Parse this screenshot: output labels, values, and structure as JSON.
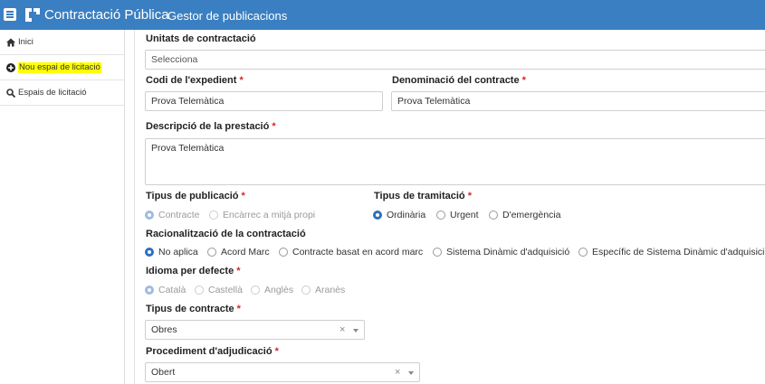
{
  "header": {
    "app_title": "Contractació Pública",
    "app_subtitle": "Gestor de publicacions"
  },
  "sidebar": {
    "items": [
      {
        "label": "Inici",
        "icon": "home-icon"
      },
      {
        "label": "Nou espai de licitació",
        "icon": "plus-circle-icon",
        "highlighted": true
      },
      {
        "label": "Espais de licitació",
        "icon": "search-icon"
      }
    ]
  },
  "form": {
    "unitats": {
      "label": "Unitats de contractació",
      "placeholder": "Selecciona"
    },
    "codi": {
      "label": "Codi de l'expedient",
      "required": "*",
      "value": "Prova Telemàtica"
    },
    "denominacio": {
      "label": "Denominació del contracte",
      "required": "*",
      "value": "Prova Telemàtica"
    },
    "descripcio": {
      "label": "Descripció de la prestació",
      "required": "*",
      "value": "Prova Telemàtica"
    },
    "tipus_publicacio": {
      "label": "Tipus de publicació",
      "required": "*",
      "options": [
        "Contracte",
        "Encàrrec a mitjà propi"
      ],
      "selected": "Contracte",
      "disabled": true
    },
    "tipus_tramitacio": {
      "label": "Tipus de tramitació",
      "required": "*",
      "options": [
        "Ordinària",
        "Urgent",
        "D'emergència"
      ],
      "selected": "Ordinària"
    },
    "racionalitzacio": {
      "label": "Racionalització de la contractació",
      "options": [
        "No aplica",
        "Acord Marc",
        "Contracte basat en acord marc",
        "Sistema Dinàmic d'adquisició",
        "Específic de Sistema Dinàmic d'adquisició"
      ],
      "selected": "No aplica"
    },
    "idioma": {
      "label": "Idioma per defecte",
      "required": "*",
      "options": [
        "Català",
        "Castellà",
        "Anglès",
        "Aranès"
      ],
      "selected": "Català",
      "disabled": true
    },
    "tipus_contracte": {
      "label": "Tipus de contracte",
      "required": "*",
      "value": "Obres",
      "clear": "×"
    },
    "procediment": {
      "label": "Procediment d'adjudicació",
      "required": "*",
      "value": "Obert",
      "clear": "×"
    }
  },
  "colors": {
    "header_bg": "#3a7fc2",
    "accent": "#2c6fbf",
    "required": "#d9232e",
    "highlight": "#ffff00"
  }
}
